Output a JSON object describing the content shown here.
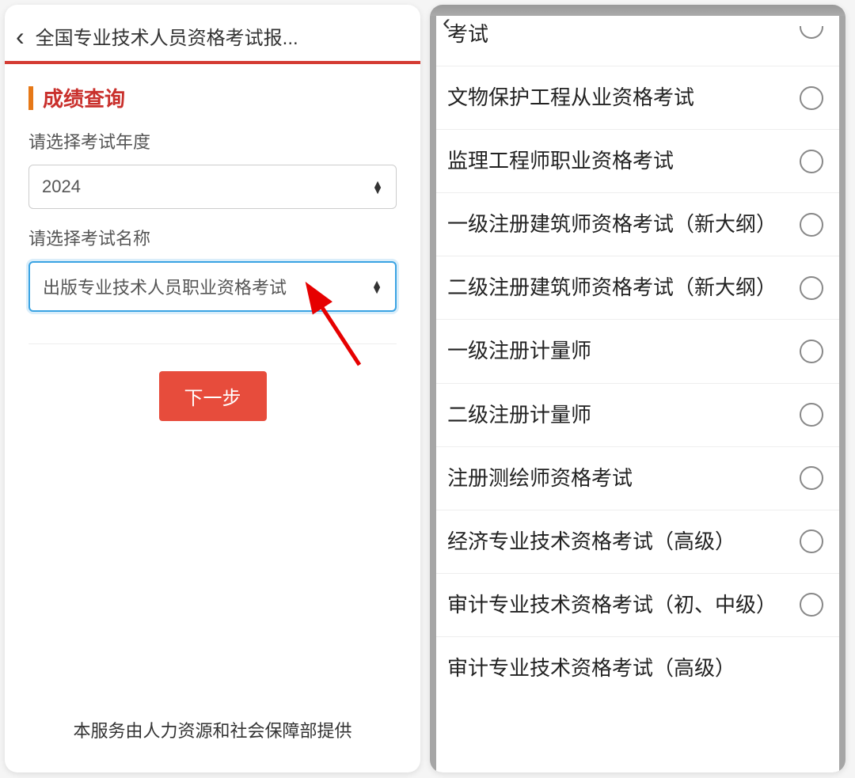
{
  "left": {
    "header_title": "全国专业技术人员资格考试报...",
    "section_title": "成绩查询",
    "year_label": "请选择考试年度",
    "year_value": "2024",
    "exam_label": "请选择考试名称",
    "exam_value": "出版专业技术人员职业资格考试",
    "next_button": "下一步",
    "footer": "本服务由人力资源和社会保障部提供"
  },
  "right": {
    "options": [
      "考试",
      "文物保护工程从业资格考试",
      "监理工程师职业资格考试",
      "一级注册建筑师资格考试（新大纲）",
      "二级注册建筑师资格考试（新大纲）",
      "一级注册计量师",
      "二级注册计量师",
      "注册测绘师资格考试",
      "经济专业技术资格考试（高级）",
      "审计专业技术资格考试（初、中级）",
      "审计专业技术资格考试（高级）"
    ]
  }
}
